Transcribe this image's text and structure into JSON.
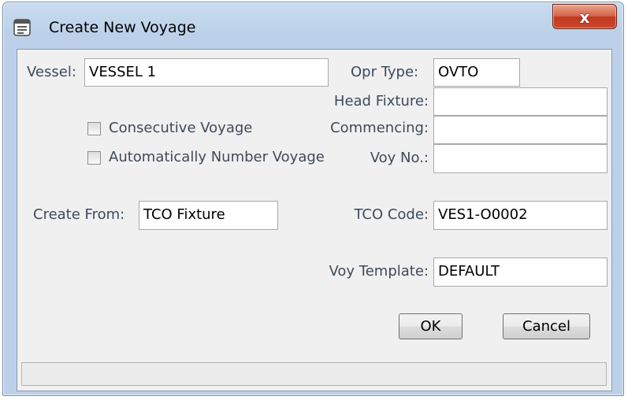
{
  "window": {
    "title": "Create New Voyage",
    "close_label": "x"
  },
  "form": {
    "vessel": {
      "label": "Vessel:",
      "value": "VESSEL 1"
    },
    "opr_type": {
      "label": "Opr Type:",
      "value": "OVTO"
    },
    "head_fixture": {
      "label": "Head Fixture:",
      "value": ""
    },
    "commencing": {
      "label": "Commencing:",
      "value": ""
    },
    "voy_no": {
      "label": "Voy No.:",
      "value": ""
    },
    "consecutive_voyage": {
      "label": "Consecutive Voyage",
      "checked": false
    },
    "auto_number_voyage": {
      "label": "Automatically Number Voyage",
      "checked": false
    },
    "create_from": {
      "label": "Create From:",
      "value": "TCO Fixture"
    },
    "tco_code": {
      "label": "TCO Code:",
      "value": "VES1-O0002"
    },
    "voy_template": {
      "label": "Voy Template:",
      "value": "DEFAULT"
    }
  },
  "buttons": {
    "ok": "OK",
    "cancel": "Cancel"
  },
  "status": {
    "text": ""
  }
}
